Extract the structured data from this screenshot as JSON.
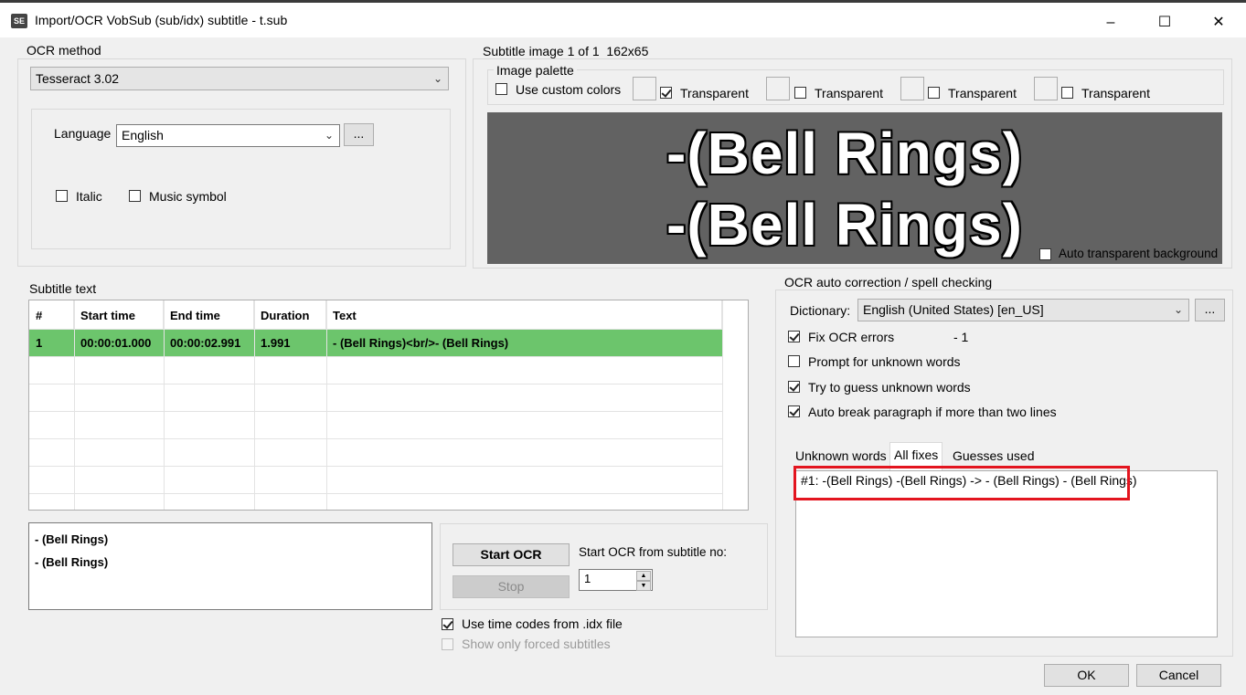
{
  "window": {
    "title": "Import/OCR VobSub (sub/idx) subtitle - t.sub",
    "icon_text": "SE"
  },
  "ocr_method": {
    "label": "OCR method",
    "engine": "Tesseract 3.02",
    "language_label": "Language",
    "language": "English",
    "browse": "...",
    "italic": "Italic",
    "music_symbol": "Music symbol"
  },
  "subtitle_image": {
    "label": "Subtitle image 1 of 1",
    "size": "162x65",
    "palette_label": "Image palette",
    "use_custom_colors": "Use custom colors",
    "transparent_label": "Transparent",
    "preview_lines": [
      "-(Bell Rings)",
      "-(Bell Rings)"
    ],
    "auto_transparent": "Auto transparent background"
  },
  "subtitle_text": {
    "label": "Subtitle text",
    "columns": [
      "#",
      "Start time",
      "End time",
      "Duration",
      "Text"
    ],
    "rows": [
      {
        "num": "1",
        "start": "00:00:01.000",
        "end": "00:00:02.991",
        "duration": "1.991",
        "text": "- (Bell Rings)<br/>- (Bell Rings)"
      }
    ],
    "edit_lines": [
      "- (Bell Rings)",
      "- (Bell Rings)"
    ]
  },
  "ocr_controls": {
    "start_ocr": "Start OCR",
    "stop": "Stop",
    "start_from_label": "Start OCR from subtitle no:",
    "start_from_value": "1",
    "use_time_codes": "Use time codes from .idx file",
    "show_forced": "Show only forced subtitles"
  },
  "autocorrect": {
    "label": "OCR auto correction / spell checking",
    "dictionary_label": "Dictionary:",
    "dictionary": "English (United States) [en_US]",
    "browse": "...",
    "fix_ocr": "Fix OCR errors",
    "fix_count": "- 1",
    "prompt_unknown": "Prompt for unknown words",
    "guess_unknown": "Try to guess unknown words",
    "auto_break": "Auto break paragraph if more than two lines",
    "tabs": [
      "Unknown words",
      "All fixes",
      "Guesses used"
    ],
    "fixes": [
      "#1: -(Bell Rings) -(Bell Rings) -> - (Bell Rings) - (Bell Rings)"
    ]
  },
  "footer": {
    "ok": "OK",
    "cancel": "Cancel"
  }
}
